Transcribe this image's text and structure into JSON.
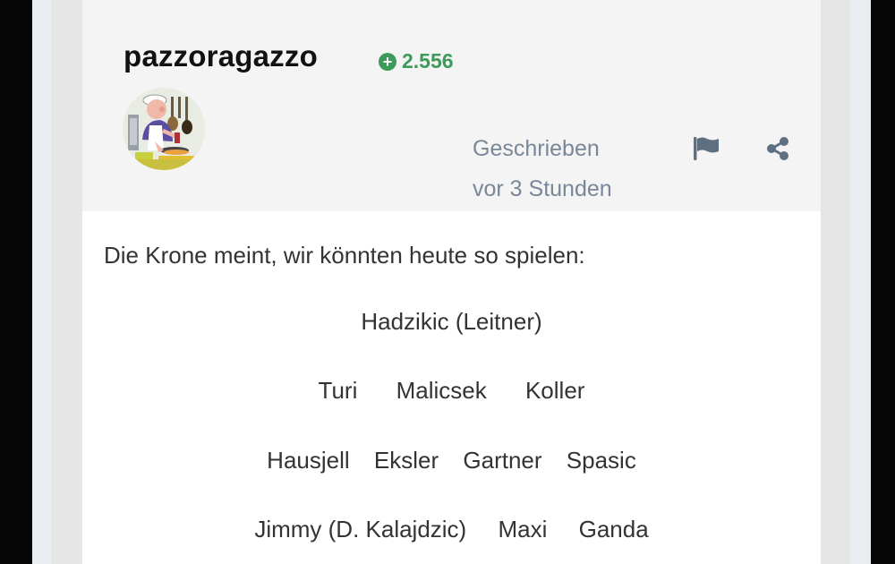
{
  "post": {
    "author": "pazzoragazzo",
    "reputation": "2.556",
    "timestamp_line1": "Geschrieben",
    "timestamp_line2": "vor 3 Stunden"
  },
  "icons": {
    "reputation": "plus-circle-icon",
    "report": "flag-icon",
    "share": "share-icon"
  },
  "content": {
    "intro": "Die Krone meint, wir könnten heute so spielen:",
    "lineup": [
      [
        "Hadzikic (Leitner)"
      ],
      [
        "Turi",
        "Malicsek",
        "Koller"
      ],
      [
        "Hausjell",
        "Eksler",
        "Gartner",
        "Spasic"
      ],
      [
        "Jimmy (D. Kalajdzic)",
        "Maxi",
        "Ganda"
      ]
    ]
  },
  "colors": {
    "reputation_green": "#3d9a5a",
    "timestamp_gray": "#7a8798",
    "icon_slate": "#5f6f82",
    "header_bg": "#f4f4f4"
  }
}
